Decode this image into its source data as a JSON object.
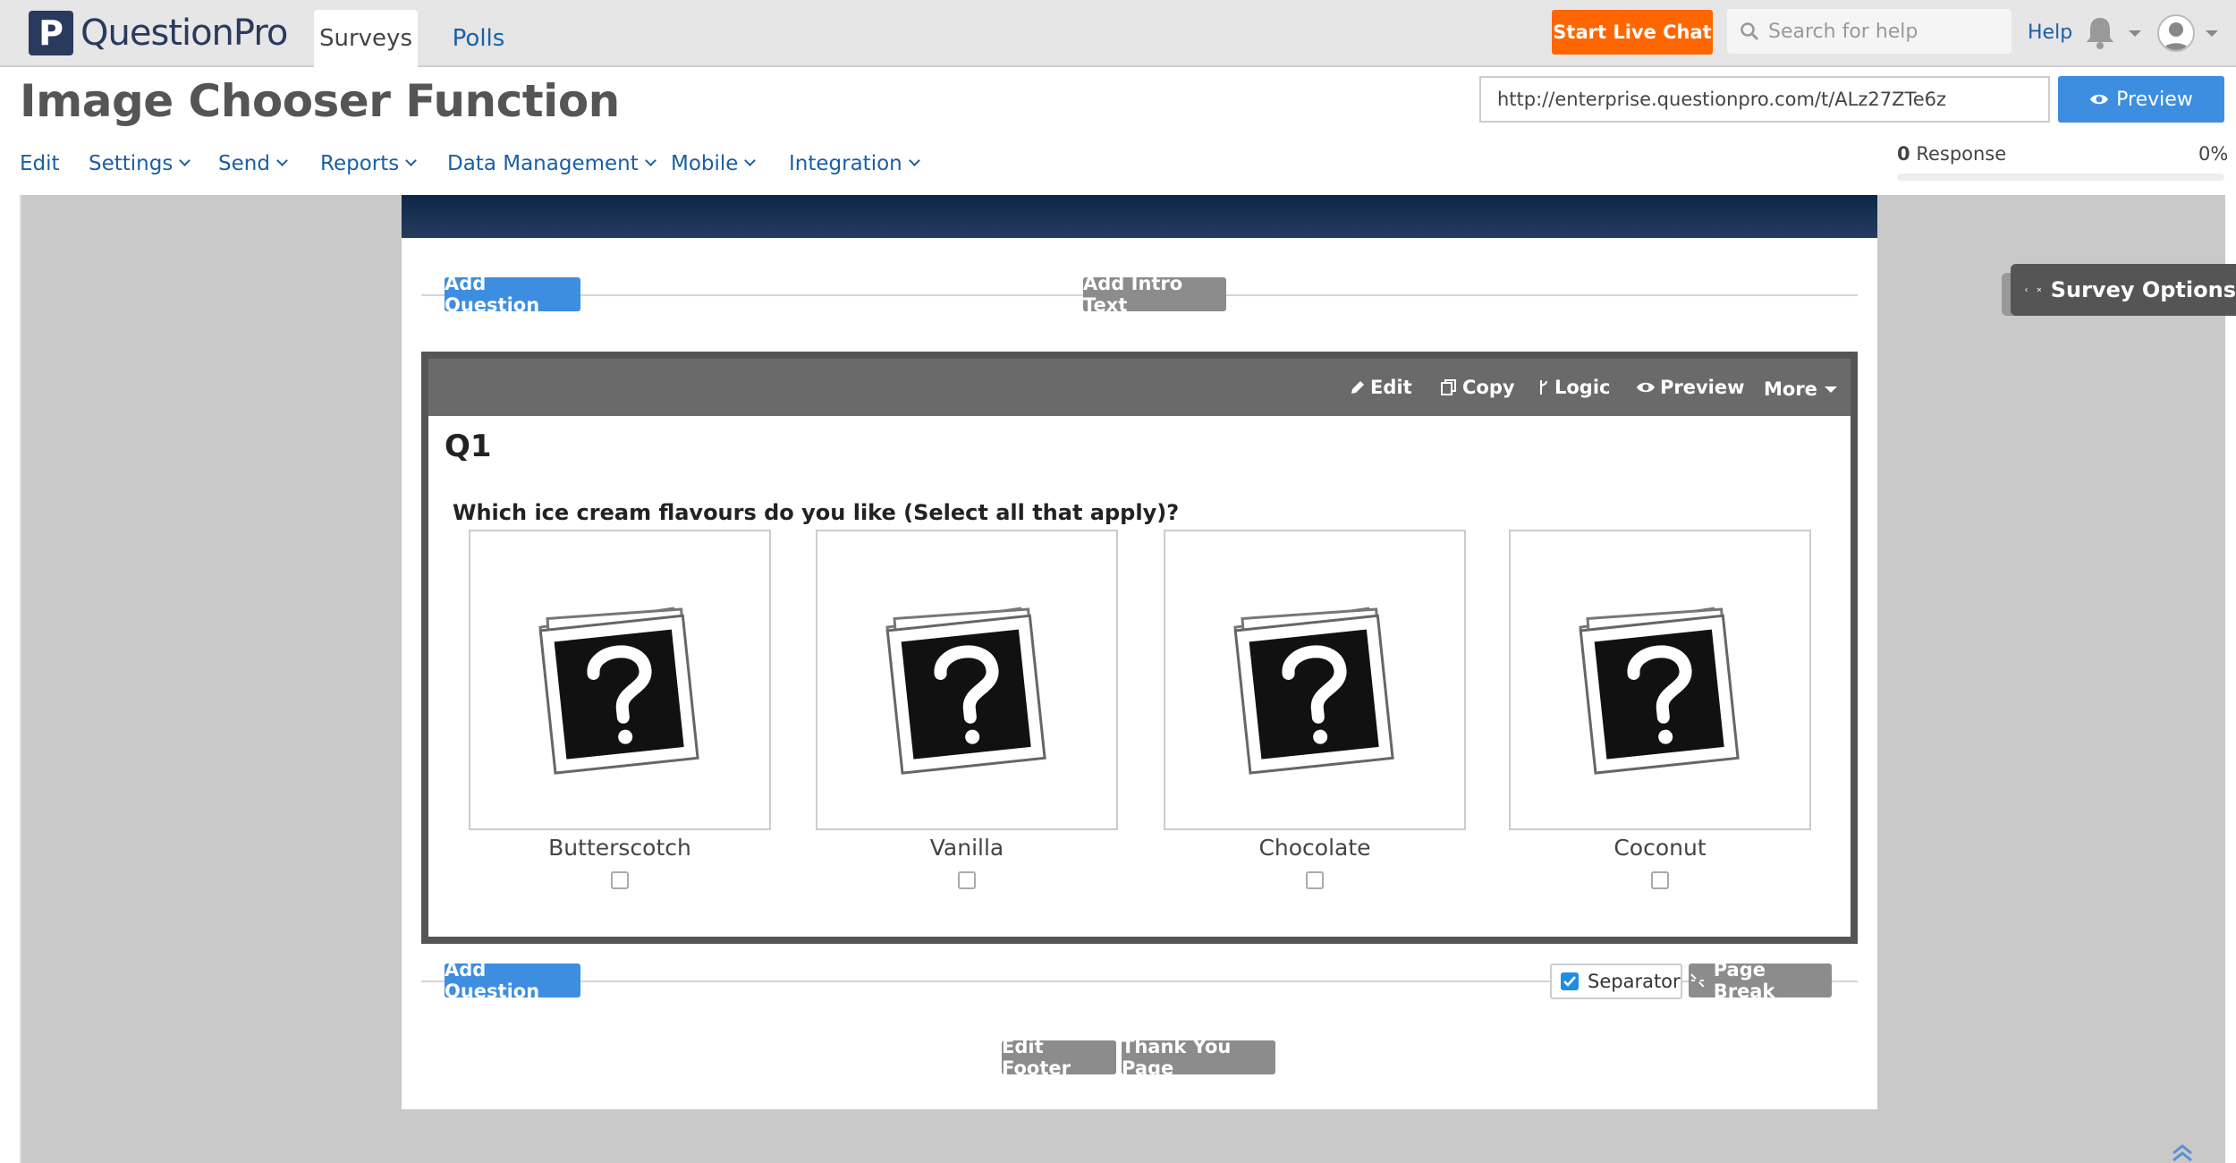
{
  "topbar": {
    "logo_letter": "P",
    "logo_text": "QuestionPro",
    "tabs": [
      {
        "label": "Surveys"
      },
      {
        "label": "Polls"
      }
    ],
    "live_chat": "Start Live Chat",
    "search_placeholder": "Search for help",
    "help": "Help"
  },
  "header": {
    "title": "Image Chooser Function",
    "url": "http://enterprise.questionpro.com/t/ALz27ZTe6z",
    "preview": "Preview"
  },
  "nav": {
    "items": [
      {
        "label": "Edit"
      },
      {
        "label": "Settings"
      },
      {
        "label": "Send"
      },
      {
        "label": "Reports"
      },
      {
        "label": "Data Management"
      },
      {
        "label": "Mobile"
      },
      {
        "label": "Integration"
      }
    ],
    "response_count": "0",
    "response_label": "Response",
    "response_pct": "0%",
    "progress_fraction": 0
  },
  "editor": {
    "add_question": "Add Question",
    "add_intro": "Add Intro Text",
    "toolbar": {
      "edit": "Edit",
      "copy": "Copy",
      "logic": "Logic",
      "preview": "Preview",
      "more": "More"
    },
    "question": {
      "number": "Q1",
      "text": "Which ice cream flavours do you like (Select all that apply)?",
      "choices": [
        {
          "label": "Butterscotch",
          "checked": false
        },
        {
          "label": "Vanilla",
          "checked": false
        },
        {
          "label": "Chocolate",
          "checked": false
        },
        {
          "label": "Coconut",
          "checked": false
        }
      ]
    },
    "separator": "Separator",
    "separator_checked": true,
    "page_break": "Page Break",
    "edit_footer": "Edit Footer",
    "thank_you": "Thank You Page",
    "survey_options": "Survey Options"
  },
  "colors": {
    "accent": "#3d8ee0",
    "brand": "#2a3a5f",
    "live_chat": "#ff6600",
    "header": "#0e2748"
  }
}
